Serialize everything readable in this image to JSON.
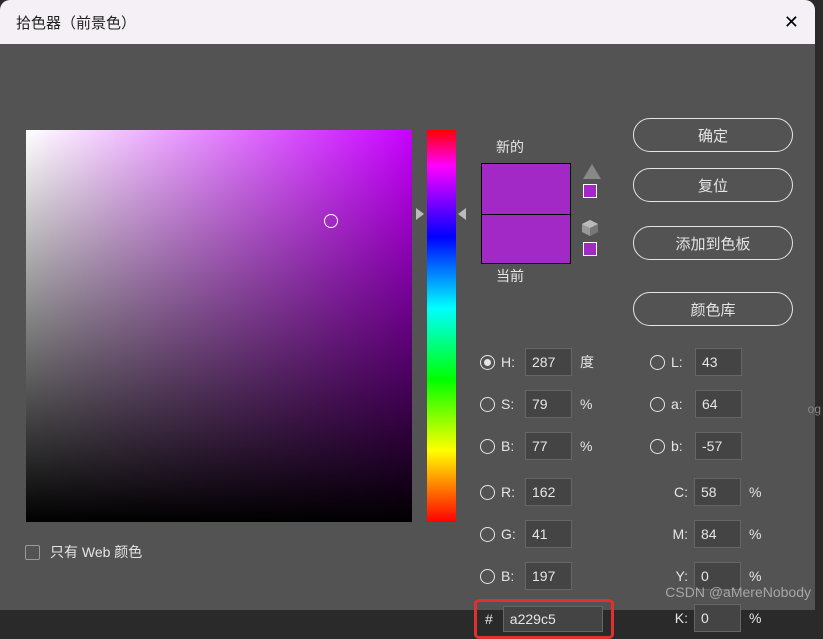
{
  "dialog": {
    "title": "拾色器（前景色）",
    "close": "✕"
  },
  "buttons": {
    "ok": "确定",
    "reset": "复位",
    "add_swatch": "添加到色板",
    "color_lib": "颜色库"
  },
  "preview": {
    "new_label": "新的",
    "current_label": "当前",
    "new_color": "#a229c5",
    "current_color": "#a229c5"
  },
  "fields": {
    "H": {
      "label": "H:",
      "value": "287",
      "unit": "度"
    },
    "S": {
      "label": "S:",
      "value": "79",
      "unit": "%"
    },
    "Bv": {
      "label": "B:",
      "value": "77",
      "unit": "%"
    },
    "R": {
      "label": "R:",
      "value": "162",
      "unit": ""
    },
    "G": {
      "label": "G:",
      "value": "41",
      "unit": ""
    },
    "Bc": {
      "label": "B:",
      "value": "197",
      "unit": ""
    },
    "L": {
      "label": "L:",
      "value": "43",
      "unit": ""
    },
    "a": {
      "label": "a:",
      "value": "64",
      "unit": ""
    },
    "b": {
      "label": "b:",
      "value": "-57",
      "unit": ""
    },
    "C": {
      "label": "C:",
      "value": "58",
      "unit": "%"
    },
    "M": {
      "label": "M:",
      "value": "84",
      "unit": "%"
    },
    "Y": {
      "label": "Y:",
      "value": "0",
      "unit": "%"
    },
    "K": {
      "label": "K:",
      "value": "0",
      "unit": "%"
    }
  },
  "hex": {
    "label": "#",
    "value": "a229c5"
  },
  "webcolor": {
    "label": "只有 Web 颜色"
  },
  "watermark": "CSDN @aMereNobody",
  "bg_text": "og"
}
